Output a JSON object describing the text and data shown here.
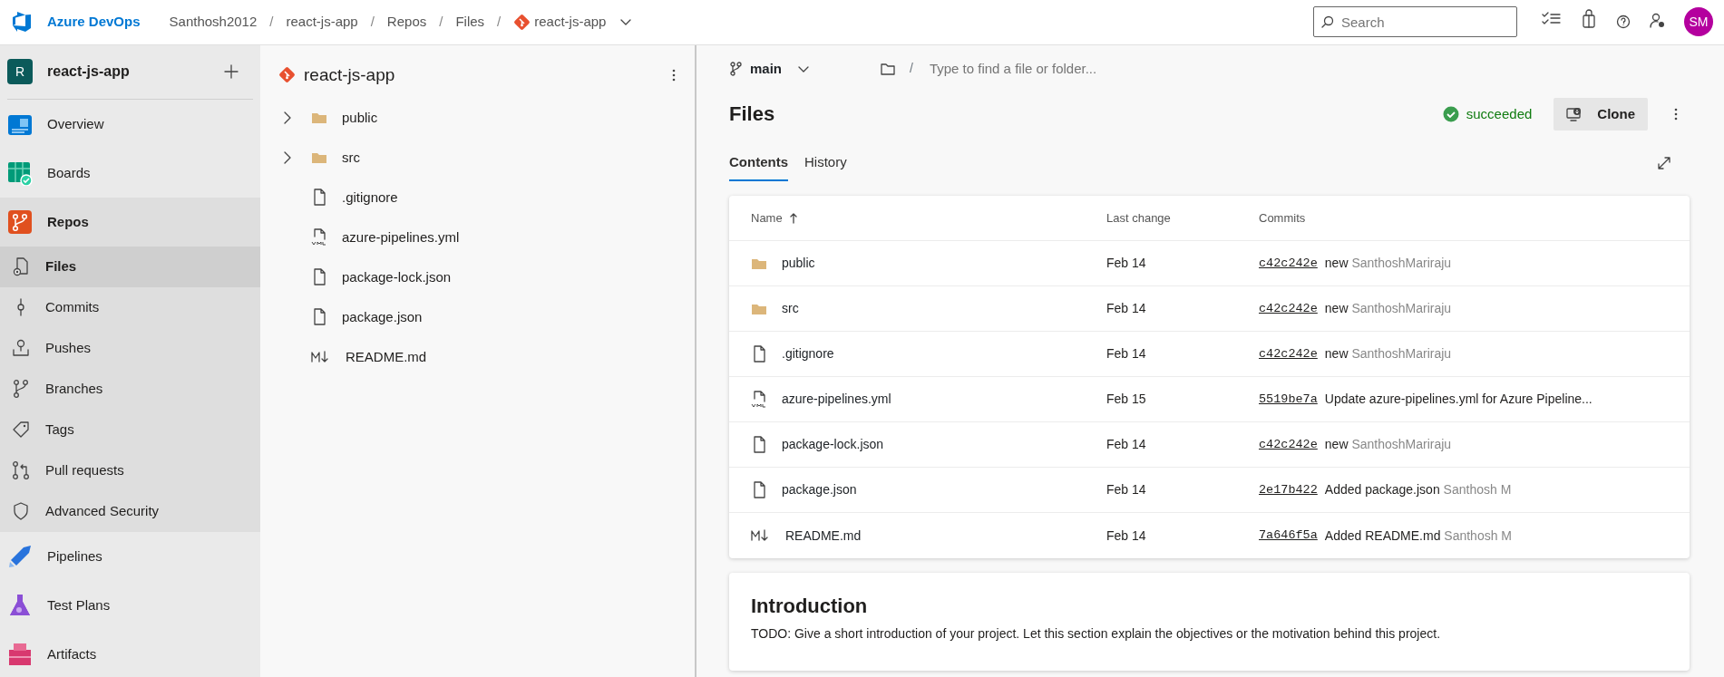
{
  "header": {
    "product": "Azure DevOps",
    "breadcrumbs": [
      {
        "text": "Santhosh2012",
        "kind": "plain"
      },
      {
        "text": "/",
        "kind": "separator"
      },
      {
        "text": "react-js-app",
        "kind": "plain"
      },
      {
        "text": "/",
        "kind": "separator"
      },
      {
        "text": "Repos",
        "kind": "plain"
      },
      {
        "text": "/",
        "kind": "separator"
      },
      {
        "text": "Files",
        "kind": "plain"
      },
      {
        "text": "/",
        "kind": "separator"
      },
      {
        "text": "react-js-app",
        "kind": "repo"
      }
    ],
    "search": {
      "placeholder": "Search"
    },
    "avatar": "SM"
  },
  "sidebar": {
    "project": {
      "initial": "R",
      "name": "react-js-app"
    },
    "items": [
      {
        "label": "Overview",
        "expanded": false,
        "selected": false
      },
      {
        "label": "Boards",
        "expanded": false,
        "selected": false
      },
      {
        "label": "Repos",
        "expanded": true,
        "selected": false,
        "children": [
          {
            "label": "Files",
            "selected": true
          },
          {
            "label": "Commits",
            "selected": false
          },
          {
            "label": "Pushes",
            "selected": false
          },
          {
            "label": "Branches",
            "selected": false
          },
          {
            "label": "Tags",
            "selected": false
          },
          {
            "label": "Pull requests",
            "selected": false
          },
          {
            "label": "Advanced Security",
            "selected": false
          }
        ]
      },
      {
        "label": "Pipelines",
        "expanded": false,
        "selected": false
      },
      {
        "label": "Test Plans",
        "expanded": false,
        "selected": false
      },
      {
        "label": "Artifacts",
        "expanded": false,
        "selected": false
      }
    ]
  },
  "tree": {
    "repo": "react-js-app",
    "items": [
      {
        "name": "public",
        "kind": "folder",
        "expanded": false
      },
      {
        "name": "src",
        "kind": "folder",
        "expanded": false
      },
      {
        "name": ".gitignore",
        "kind": "file"
      },
      {
        "name": "azure-pipelines.yml",
        "kind": "yaml"
      },
      {
        "name": "package-lock.json",
        "kind": "file"
      },
      {
        "name": "package.json",
        "kind": "file"
      },
      {
        "name": "README.md",
        "kind": "markdown"
      }
    ]
  },
  "main": {
    "branch": "main",
    "path_search": {
      "separator": "/",
      "placeholder": "Type to find a file or folder..."
    },
    "title": "Files",
    "status": "succeeded",
    "clone_button": "Clone",
    "tabs": [
      {
        "label": "Contents",
        "selected": true
      },
      {
        "label": "History",
        "selected": false
      }
    ],
    "table": {
      "columns": [
        {
          "label": "Name",
          "sorted": true
        },
        {
          "label": "Last change",
          "sorted": false
        },
        {
          "label": "Commits",
          "sorted": false
        }
      ],
      "rows": [
        {
          "name": "public",
          "kind": "folder",
          "last_change": "Feb 14",
          "hash": "c42c242e",
          "message": "new",
          "author": "SanthoshMariraju"
        },
        {
          "name": "src",
          "kind": "folder",
          "last_change": "Feb 14",
          "hash": "c42c242e",
          "message": "new",
          "author": "SanthoshMariraju"
        },
        {
          "name": ".gitignore",
          "kind": "file",
          "last_change": "Feb 14",
          "hash": "c42c242e",
          "message": "new",
          "author": "SanthoshMariraju"
        },
        {
          "name": "azure-pipelines.yml",
          "kind": "yaml",
          "last_change": "Feb 15",
          "hash": "5519be7a",
          "message": "Update azure-pipelines.yml for Azure Pipeline..."
        },
        {
          "name": "package-lock.json",
          "kind": "file",
          "last_change": "Feb 14",
          "hash": "c42c242e",
          "message": "new",
          "author": "SanthoshMariraju"
        },
        {
          "name": "package.json",
          "kind": "file",
          "last_change": "Feb 14",
          "hash": "2e17b422",
          "message": "Added package.json",
          "author": "Santhosh M"
        },
        {
          "name": "README.md",
          "kind": "markdown",
          "last_change": "Feb 14",
          "hash": "7a646f5a",
          "message": "Added README.md",
          "author": "Santhosh M"
        }
      ]
    },
    "readme": {
      "heading": "Introduction",
      "text": "TODO: Give a short introduction of your project. Let this section explain the objectives or the motivation behind this project."
    }
  }
}
